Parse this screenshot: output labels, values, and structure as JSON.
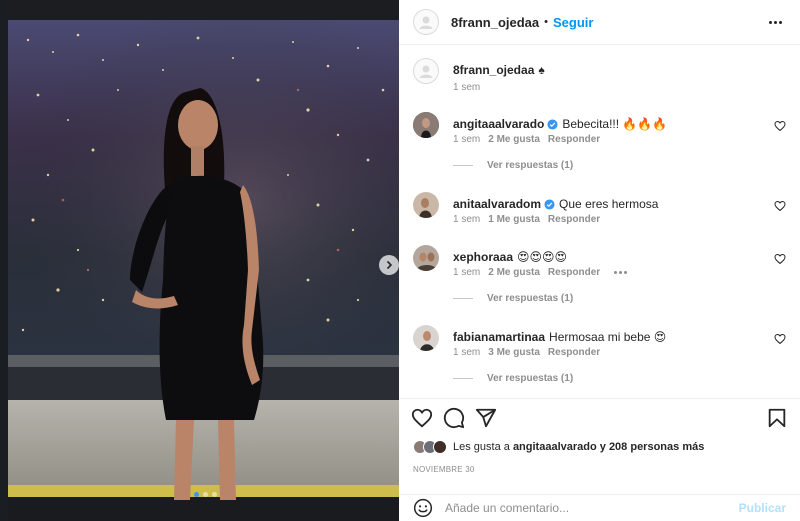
{
  "post": {
    "author": "8frann_ojedaa",
    "follow_label": "Seguir",
    "separator": "•",
    "caption_username": "8frann_ojedaa",
    "caption_text": "♠",
    "caption_time": "1 sem",
    "likes_prefix": "Les gusta a",
    "likes_user": "angitaaalvarado",
    "likes_suffix": "y 208 personas más",
    "date": "NOVIEMBRE 30",
    "carousel_count": 3,
    "carousel_active": 1
  },
  "comments": [
    {
      "username": "angitaaalvarado",
      "verified": true,
      "text": "Bebecita!!! 🔥🔥🔥",
      "time": "1 sem",
      "likes": "2 Me gusta",
      "reply": "Responder",
      "view_replies": "Ver respuestas (1)"
    },
    {
      "username": "anitaalvaradom",
      "verified": true,
      "text": "Que eres hermosa",
      "time": "1 sem",
      "likes": "1 Me gusta",
      "reply": "Responder"
    },
    {
      "username": "xephoraaa",
      "verified": false,
      "text": "😍😍😍😍",
      "time": "1 sem",
      "likes": "2 Me gusta",
      "reply": "Responder",
      "view_replies": "Ver respuestas (1)"
    },
    {
      "username": "fabianamartinaa",
      "verified": false,
      "text": "Hermosaa mi bebe 😍",
      "time": "1 sem",
      "likes": "3 Me gusta",
      "reply": "Responder",
      "view_replies": "Ver respuestas (1)"
    }
  ],
  "composer": {
    "placeholder": "Añade un comentario...",
    "publish_label": "Publicar"
  },
  "colors": {
    "link_blue": "#0095f6",
    "publish_disabled": "#b2dffc",
    "verified_blue": "#3897f0",
    "muted": "#8e8e8e"
  },
  "icons": [
    "more-icon",
    "heart-icon",
    "comment-icon",
    "share-icon",
    "bookmark-icon",
    "emoji-icon",
    "verified-icon",
    "chevron-right-icon"
  ]
}
